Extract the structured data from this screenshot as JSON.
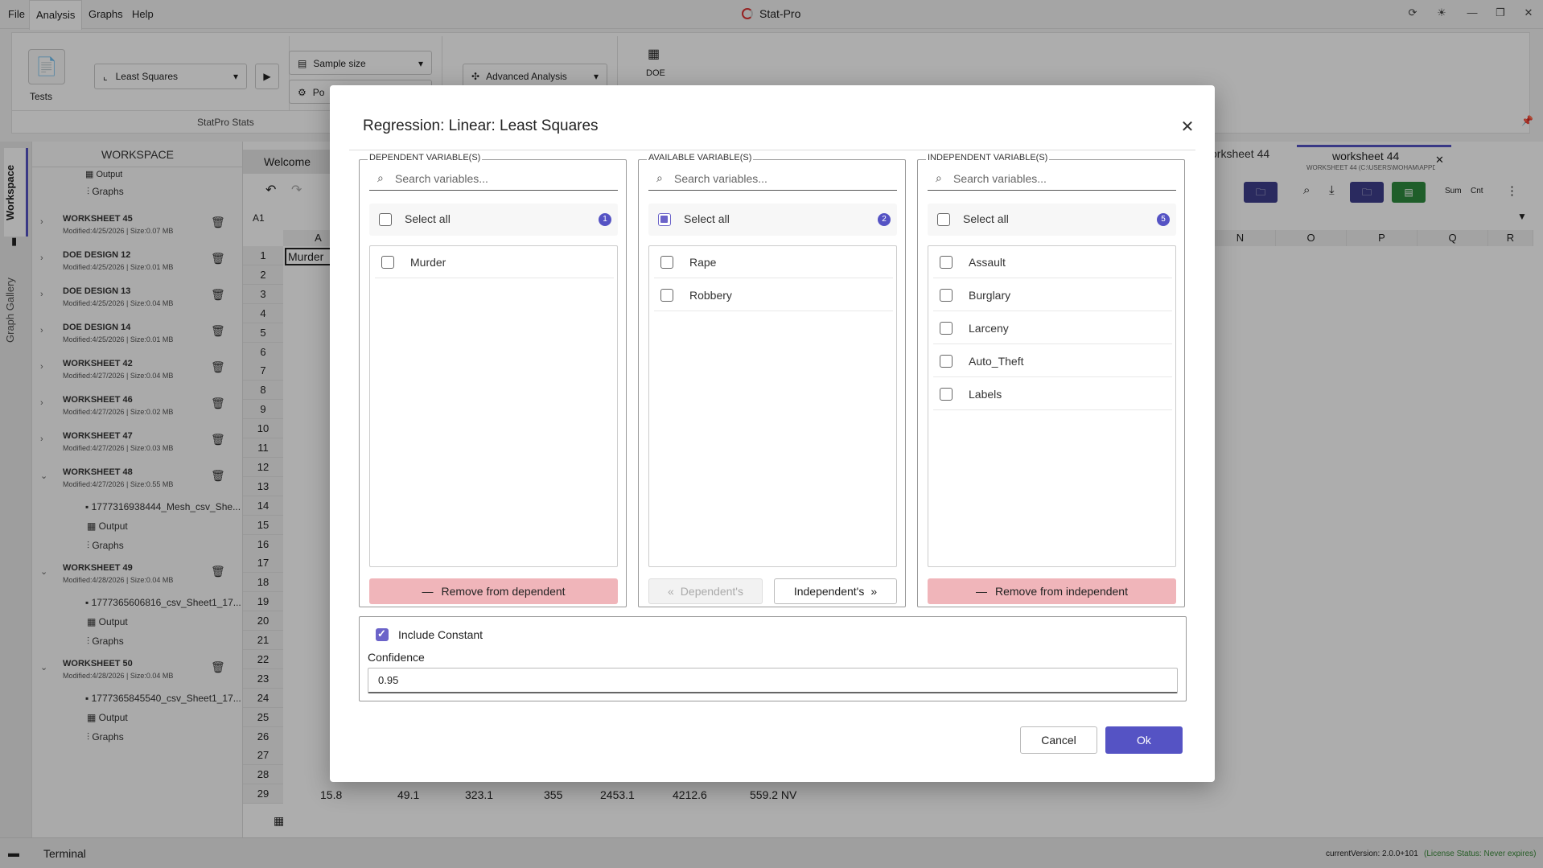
{
  "menu": [
    "File",
    "Analysis",
    "Graphs",
    "Help"
  ],
  "app_title": "Stat-Pro",
  "ribbon": {
    "tests_label": "Tests",
    "method": "Least Squares",
    "sample_size": "Sample size",
    "power": "Po",
    "advanced": "Advanced Analysis",
    "doe": "DOE",
    "group_label": "StatPro Stats"
  },
  "left_tabs": [
    "Workspace",
    "Graph Gallery"
  ],
  "workspace": {
    "title": "WORKSPACE",
    "top_subs": [
      "Output",
      "Graphs"
    ],
    "items": [
      {
        "name": "WORKSHEET 45",
        "meta": "Modified:4/25/2026  |  Size:0.07 MB"
      },
      {
        "name": "DOE DESIGN 12",
        "meta": "Modified:4/25/2026  |  Size:0.01 MB"
      },
      {
        "name": "DOE DESIGN 13",
        "meta": "Modified:4/25/2026  |  Size:0.04 MB"
      },
      {
        "name": "DOE DESIGN 14",
        "meta": "Modified:4/25/2026  |  Size:0.01 MB"
      },
      {
        "name": "WORKSHEET 42",
        "meta": "Modified:4/27/2026  |  Size:0.04 MB"
      },
      {
        "name": "WORKSHEET 46",
        "meta": "Modified:4/27/2026  |  Size:0.02 MB"
      },
      {
        "name": "WORKSHEET 47",
        "meta": "Modified:4/27/2026  |  Size:0.03 MB"
      },
      {
        "name": "WORKSHEET 48",
        "meta": "Modified:4/27/2026  |  Size:0.55 MB"
      },
      {
        "name": "WORKSHEET 49",
        "meta": "Modified:4/28/2026  |  Size:0.04 MB"
      },
      {
        "name": "WORKSHEET 50",
        "meta": "Modified:4/28/2026  |  Size:0.04 MB"
      }
    ],
    "subs_48": [
      "1777316938444_Mesh_csv_She...",
      "Output",
      "Graphs"
    ],
    "subs_49": [
      "1777365606816_csv_Sheet1_17...",
      "Output",
      "Graphs"
    ],
    "subs_50": [
      "1777365845540_csv_Sheet1_17...",
      "Output",
      "Graphs"
    ]
  },
  "sheet": {
    "tab_welcome": "Welcome",
    "tab_ws44a": "orksheet 44",
    "tab_ws44": "worksheet 44",
    "tab_ws44_path": "WORKSHEET 44 (C:\\USERS\\MOHAM\\APPD...",
    "cell_ref": "A1",
    "cell_a1": "Murder",
    "col_a": "A",
    "cols_right": [
      "N",
      "O",
      "P",
      "Q",
      "R"
    ],
    "rows": [
      "1",
      "2",
      "3",
      "4",
      "5",
      "6",
      "7",
      "8",
      "9",
      "10",
      "11",
      "12",
      "13",
      "14",
      "15",
      "16",
      "17",
      "18",
      "19",
      "20",
      "21",
      "22",
      "23",
      "24",
      "25",
      "26",
      "27",
      "28",
      "29"
    ],
    "row29_vals": [
      "15.8",
      "49.1",
      "323.1",
      "355",
      "2453.1",
      "4212.6",
      "559.2 NV"
    ],
    "toolbar_sum": "Sum",
    "toolbar_cnt": "Cnt"
  },
  "status": {
    "terminal": "Terminal",
    "version": "currentVersion: 2.0.0+101",
    "license": "(License Status: Never expires)"
  },
  "dialog": {
    "title": "Regression: Linear: Least Squares",
    "search_placeholder": "Search variables...",
    "select_all": "Select all",
    "dependent": {
      "legend": "DEPENDENT VARIABLE(S)",
      "count": "1",
      "items": [
        "Murder"
      ],
      "remove_label": "Remove from dependent"
    },
    "available": {
      "legend": "AVAILABLE VARIABLE(S)",
      "count": "2",
      "items": [
        "Rape",
        "Robbery"
      ],
      "dependents_btn": "Dependent's",
      "independents_btn": "Independent's"
    },
    "independent": {
      "legend": "INDEPENDENT VARIABLE(S)",
      "count": "5",
      "items": [
        "Assault",
        "Burglary",
        "Larceny",
        "Auto_Theft",
        "Labels"
      ],
      "remove_label": "Remove from independent"
    },
    "include_constant": "Include Constant",
    "confidence_label": "Confidence",
    "confidence_value": "0.95",
    "cancel": "Cancel",
    "ok": "Ok"
  },
  "colors": {
    "accent": "#5553c4",
    "remove_bg": "#f0b5ba",
    "overlay": "rgba(0,0,0,0.32)"
  }
}
